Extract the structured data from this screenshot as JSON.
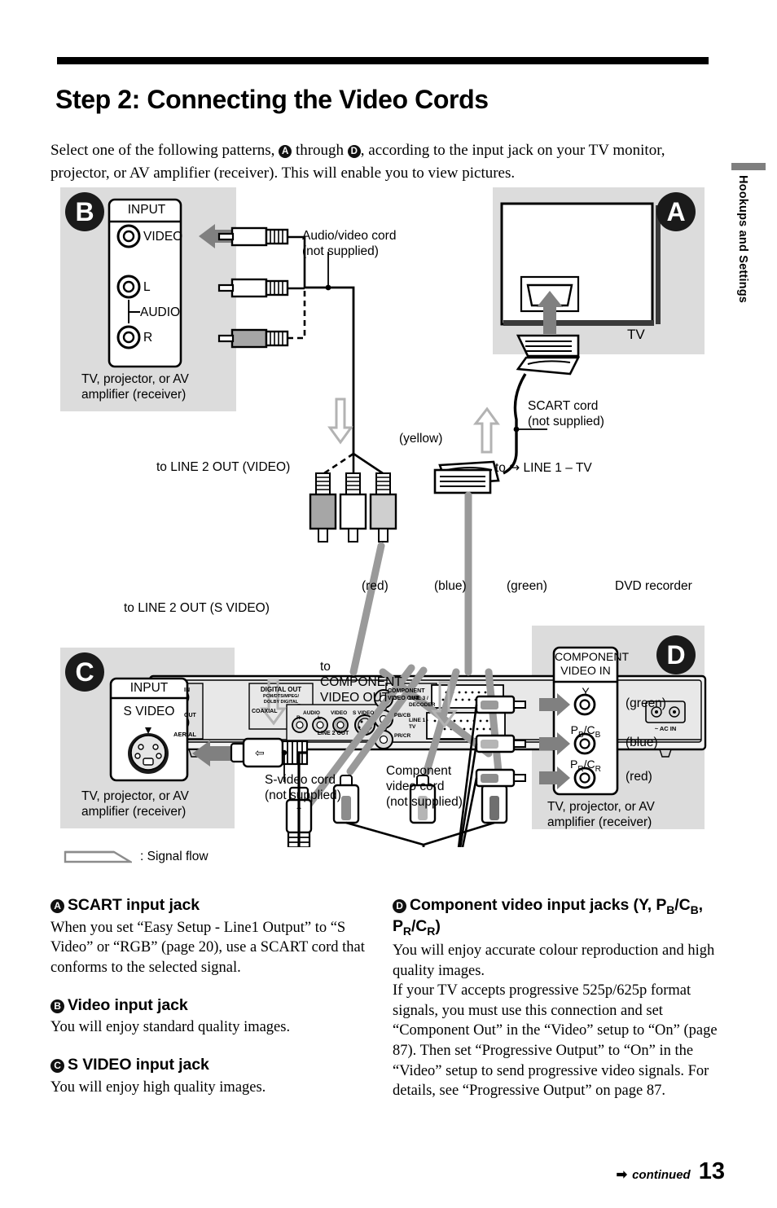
{
  "header": {
    "title": "Step 2: Connecting the Video Cords",
    "intro_1": "Select one of the following patterns, ",
    "intro_a": "A",
    "intro_2": " through ",
    "intro_d": "D",
    "intro_3": ", according to the input jack on your TV monitor, projector, or AV amplifier (receiver). This will enable you to view pictures."
  },
  "side_tab": {
    "label": "Hookups and Settings"
  },
  "diagram": {
    "badges": {
      "a": "A",
      "b": "B",
      "c": "C",
      "d": "D"
    },
    "panel_b": {
      "input_header": "INPUT",
      "jack_video": "VIDEO",
      "jack_l": "L",
      "jack_audio": "AUDIO",
      "jack_r": "R",
      "caption_line1": "TV, projector, or AV",
      "caption_line2": "amplifier (receiver)"
    },
    "panel_a": {
      "tv_label": "TV"
    },
    "panel_c": {
      "input_header": "INPUT",
      "jack_svideo": "S VIDEO",
      "caption_line1": "TV, projector, or AV",
      "caption_line2": "amplifier (receiver)"
    },
    "panel_d": {
      "header_line1": "COMPONENT",
      "header_line2": "VIDEO IN",
      "jack_y": "Y",
      "jack_pb": "PB/CB",
      "jack_pr": "PR/CR",
      "color_green": "(green)",
      "color_blue": "(blue)",
      "color_red": "(red)",
      "caption_line1": "TV, projector, or AV",
      "caption_line2": "amplifier (receiver)"
    },
    "labels": {
      "av_cord_line1": "Audio/video cord",
      "av_cord_line2": "(not supplied)",
      "scart_cord_line1": "SCART cord",
      "scart_cord_line2": "(not supplied)",
      "yellow": "(yellow)",
      "to_line2_video": "to LINE 2 OUT (VIDEO)",
      "to_line1_tv": "to ↪ LINE 1 – TV",
      "to_line2_svideo": "to LINE 2 OUT (S VIDEO)",
      "to_component_line1": "to",
      "to_component_line2": "COMPONENT",
      "to_component_line3": "VIDEO OUT",
      "svideo_cord_line1": "S-video cord",
      "svideo_cord_line2": "(not supplied)",
      "component_cord_line1": "Component",
      "component_cord_line2": "video cord",
      "component_cord_line3": "(not supplied)",
      "color_red": "(red)",
      "color_blue": "(blue)",
      "color_green": "(green)",
      "dvd_recorder": "DVD recorder"
    },
    "recorder": {
      "in": "IN",
      "out": "OUT",
      "aerial": "AERIAL",
      "digital_out": "DIGITAL OUT",
      "digital_out_sub1": "PCM/DTS/MPEG/",
      "digital_out_sub2": "DOLBY DIGITAL",
      "coaxial": "COAXIAL",
      "audio": "AUDIO",
      "r": "R",
      "l": "L",
      "video": "VIDEO",
      "s_video": "S VIDEO",
      "line2_out": "LINE 2 OUT",
      "component_video_out_1": "COMPONENT",
      "component_video_out_2": "VIDEO OUT",
      "y": "Y",
      "pb_cb": "PB/CB",
      "pr_cr": "PR/CR",
      "line3_1": "LINE 3 /",
      "line3_2": "DECODER",
      "line1_1": "LINE 1 -",
      "line1_2": "TV",
      "ac_in": "~ AC IN"
    },
    "legend": {
      "label": ": Signal flow"
    }
  },
  "sections": {
    "a": {
      "badge": "A",
      "heading": "SCART input jack",
      "body": "When you set “Easy Setup - Line1 Output” to “S Video” or “RGB” (page 20), use a SCART cord that conforms to the selected signal."
    },
    "b": {
      "badge": "B",
      "heading": "Video input jack",
      "body": "You will enjoy standard quality images."
    },
    "c": {
      "badge": "C",
      "heading": "S VIDEO input jack",
      "body": "You will enjoy high quality images."
    },
    "d": {
      "badge": "D",
      "heading_pre": "Component video input jacks (Y, P",
      "heading_sub1": "B",
      "heading_mid": "/C",
      "heading_sub2": "B",
      "heading_mid2": ", P",
      "heading_sub3": "R",
      "heading_mid3": "/C",
      "heading_sub4": "R",
      "heading_post": ")",
      "body_1": "You will enjoy accurate colour reproduction and high quality images.",
      "body_2": "If your TV accepts progressive 525p/625p format signals, you must use this connection and set “Component Out” in the “Video” setup to “On” (page 87). Then set “Progressive Output” to “On” in the “Video” setup to send progressive video signals. For details, see “Progressive Output” on page 87."
    }
  },
  "footer": {
    "continued": "continued",
    "page_number": "13"
  },
  "colors": {
    "zone_grey": "#dcdcdc",
    "arrow_grey": "#808080",
    "ink": "#000000"
  }
}
